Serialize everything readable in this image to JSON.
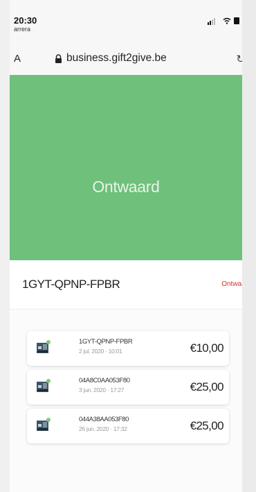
{
  "status_bar": {
    "time": "20:30",
    "carrier": "arrera"
  },
  "browser": {
    "aa_label": "A",
    "url": "business.gift2give.be"
  },
  "hero": {
    "title": "Ontwaard",
    "color": "#6ec07a"
  },
  "voucher": {
    "code": "1GYT-QPNP-FPBR",
    "status_label": "Ontwaar",
    "status_color": "#d9302c"
  },
  "transactions": [
    {
      "code": "1GYT-QPNP-FPBR",
      "date": "2 jul. 2020 · 10:01",
      "amount": "€10,00"
    },
    {
      "code": "04A8C0AA053F80",
      "date": "3 jun. 2020 · 17:27",
      "amount": "€25,00"
    },
    {
      "code": "044A38AA053F80",
      "date": "26 jun. 2020 · 17:32",
      "amount": "€25,00"
    }
  ]
}
